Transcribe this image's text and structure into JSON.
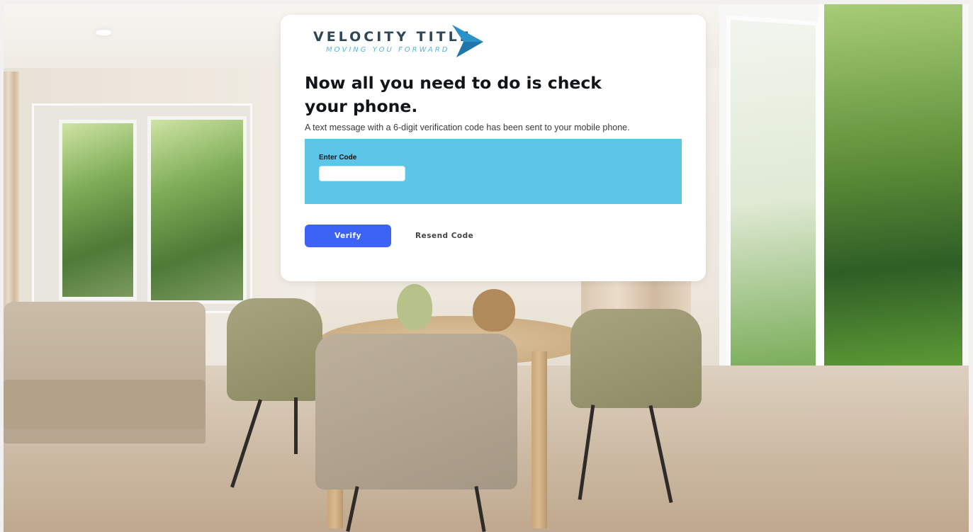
{
  "brand": {
    "name": "VELOCITY TITLE",
    "tagline": "MOVING YOU FORWARD",
    "colors": {
      "primary_text": "#2f4858",
      "accent": "#4fb7e3",
      "button": "#3d63f5",
      "panel": "#5bc6e8"
    }
  },
  "verification": {
    "headline": "Now all you need to do is check your phone.",
    "subtext": "A text message with a 6-digit verification code has been sent to your mobile phone.",
    "code_label": "Enter Code",
    "code_value": "",
    "code_placeholder": "",
    "verify_label": "Verify",
    "resend_label": "Resend Code"
  },
  "icons": {
    "logo_mark": "blue-arrow-icon"
  }
}
